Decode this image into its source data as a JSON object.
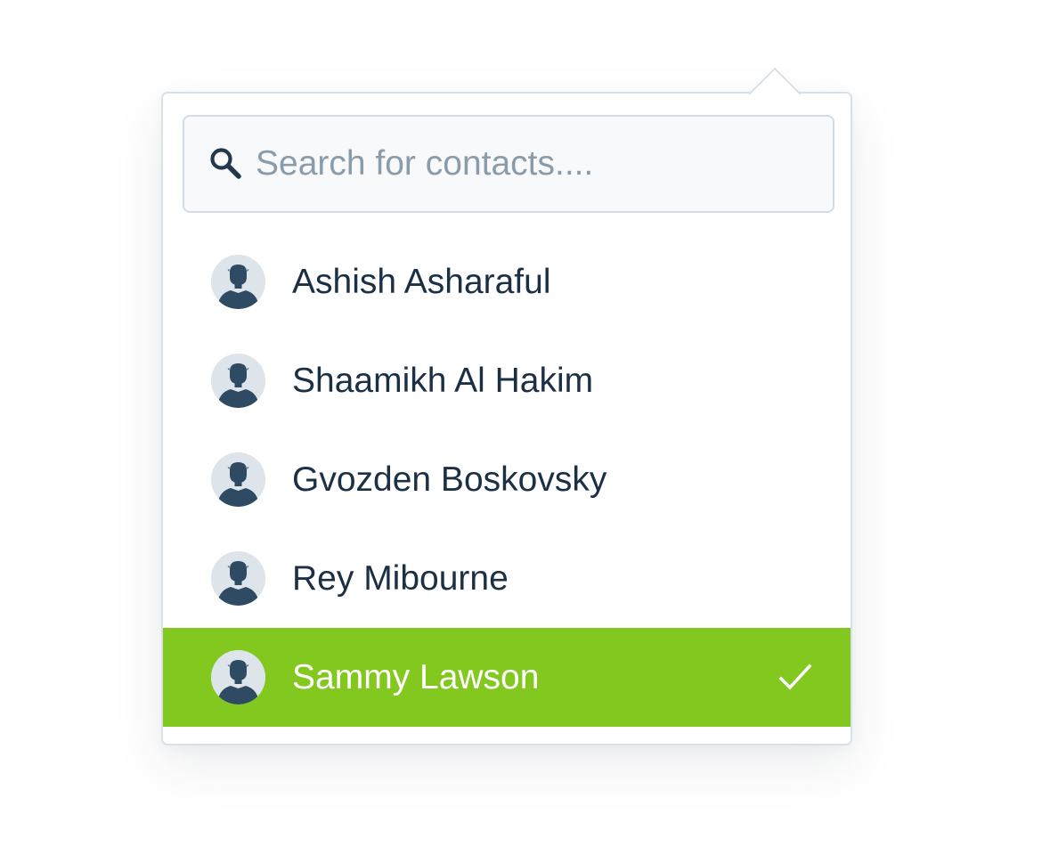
{
  "search": {
    "placeholder": "Search for contacts....",
    "value": "",
    "icon": "search-icon"
  },
  "contacts": [
    {
      "name": "Ashish Asharaful",
      "avatar_icon": "person-silhouette-icon",
      "selected": false
    },
    {
      "name": "Shaamikh Al Hakim",
      "avatar_icon": "person-silhouette-icon",
      "selected": false
    },
    {
      "name": "Gvozden Boskovsky",
      "avatar_icon": "person-silhouette-icon",
      "selected": false
    },
    {
      "name": "Rey Mibourne",
      "avatar_icon": "person-silhouette-icon",
      "selected": false
    },
    {
      "name": "Sammy Lawson",
      "avatar_icon": "person-silhouette-icon",
      "selected": true,
      "status_icon": "checkmark-icon"
    }
  ],
  "colors": {
    "selected_background": "#83c81f",
    "text_primary": "#1c3045",
    "placeholder_text": "#8a9baa",
    "border": "#d9e1e8",
    "avatar_background": "#dde4ea",
    "avatar_figure": "#2f4a63"
  }
}
